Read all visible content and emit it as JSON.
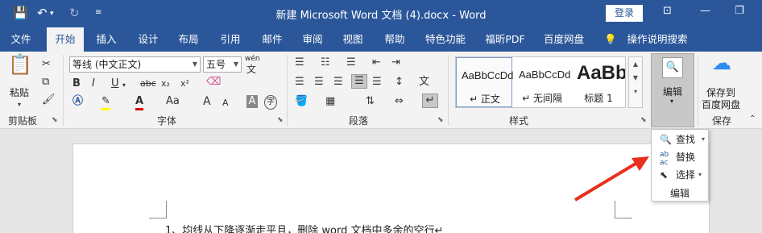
{
  "titlebar": {
    "title": "新建 Microsoft Word 文档 (4).docx - Word",
    "login_label": "登录",
    "qa_save_icon": "save-icon",
    "qa_undo_icon": "undo-icon",
    "qa_redo_icon": "redo-icon"
  },
  "tabs": [
    "文件",
    "开始",
    "插入",
    "设计",
    "布局",
    "引用",
    "邮件",
    "审阅",
    "视图",
    "帮助",
    "特色功能",
    "福昕PDF",
    "百度网盘"
  ],
  "tell_me": "操作说明搜索",
  "ribbon": {
    "clipboard": {
      "paste_label": "粘贴",
      "group_label": "剪贴板"
    },
    "font": {
      "font_name": "等线 (中文正文)",
      "font_size": "五号",
      "pinyin_label": "wén",
      "group_label": "字体",
      "bold": "B",
      "italic": "I",
      "underline": "U",
      "strike": "abc",
      "subscript": "x₂",
      "superscript": "x²",
      "case_label": "Aa",
      "grow": "A",
      "shrink": "A",
      "char_border": "A",
      "enclose": "字"
    },
    "paragraph": {
      "group_label": "段落"
    },
    "styles": {
      "group_label": "样式",
      "items": [
        {
          "preview": "AaBbCcDd",
          "name": "↵ 正文"
        },
        {
          "preview": "AaBbCcDd",
          "name": "↵ 无间隔"
        },
        {
          "preview": "AaBb",
          "name": "标题 1"
        }
      ]
    },
    "editing": {
      "button_label": "编辑"
    },
    "save": {
      "line1": "保存到",
      "line2": "百度网盘",
      "group_label": "保存"
    }
  },
  "dropdown": {
    "items": [
      {
        "icon": "search-icon",
        "label": "查找"
      },
      {
        "icon": "replace-icon",
        "label": "替换"
      },
      {
        "icon": "select-cursor-icon",
        "label": "选择"
      }
    ],
    "footer": "编辑"
  },
  "document": {
    "line1": "1、均线从下降逐渐走平且，删除 word 文档中多余的空行↵"
  },
  "colors": {
    "brand": "#2b579a",
    "annotation_arrow": "#e8301c"
  }
}
